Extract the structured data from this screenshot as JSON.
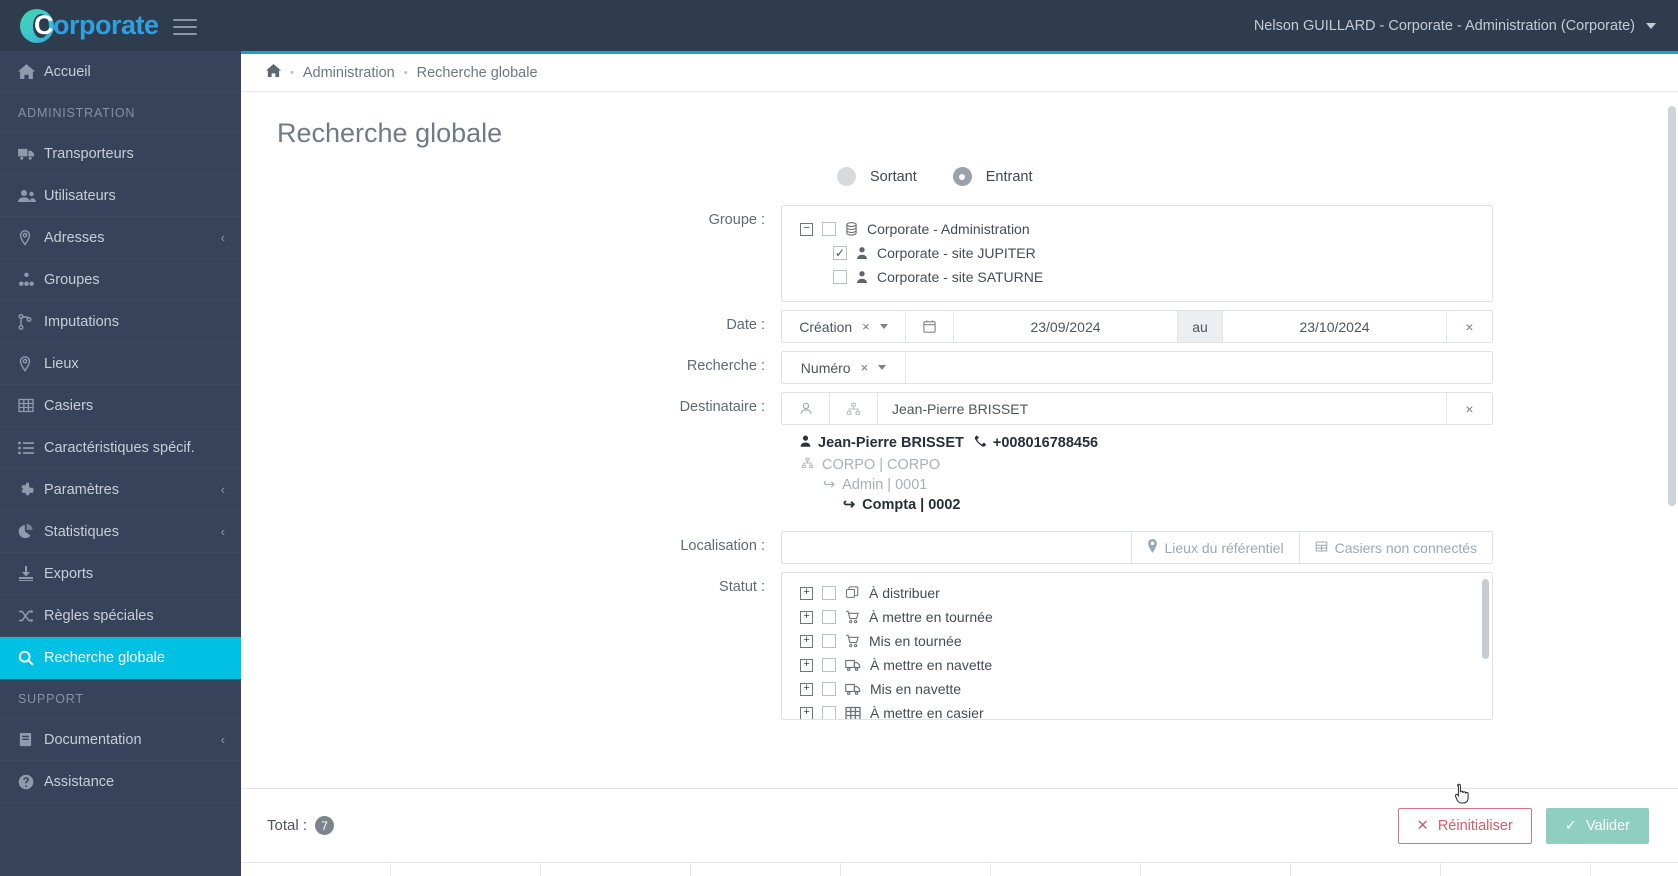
{
  "topbar": {
    "logo_c": "C",
    "logo_rest": "orporate",
    "user_menu": "Nelson GUILLARD - Corporate - Administration (Corporate)"
  },
  "sidebar": {
    "home": {
      "label": "Accueil",
      "icon": "home-icon"
    },
    "section_admin": "ADMINISTRATION",
    "section_support": "SUPPORT",
    "items": [
      {
        "label": "Transporteurs",
        "icon": "truck-icon",
        "caret": "",
        "active": false
      },
      {
        "label": "Utilisateurs",
        "icon": "users-icon",
        "caret": "",
        "active": false
      },
      {
        "label": "Adresses",
        "icon": "map-marker-icon",
        "caret": "‹",
        "active": false
      },
      {
        "label": "Groupes",
        "icon": "sitemap-icon",
        "caret": "",
        "active": false
      },
      {
        "label": "Imputations",
        "icon": "code-branch-icon",
        "caret": "",
        "active": false
      },
      {
        "label": "Lieux",
        "icon": "map-marker-icon",
        "caret": "",
        "active": false
      },
      {
        "label": "Casiers",
        "icon": "grid-icon",
        "caret": "",
        "active": false
      },
      {
        "label": "Caractéristiques spécif.",
        "icon": "list-icon",
        "caret": "",
        "active": false
      },
      {
        "label": "Paramètres",
        "icon": "gear-icon",
        "caret": "‹",
        "active": false
      },
      {
        "label": "Statistiques",
        "icon": "pie-chart-icon",
        "caret": "‹",
        "active": false
      },
      {
        "label": "Exports",
        "icon": "download-icon",
        "caret": "",
        "active": false
      },
      {
        "label": "Règles spéciales",
        "icon": "shuffle-icon",
        "caret": "",
        "active": false
      },
      {
        "label": "Recherche globale",
        "icon": "search-icon",
        "caret": "",
        "active": true
      }
    ],
    "support_items": [
      {
        "label": "Documentation",
        "icon": "book-icon",
        "caret": "‹"
      },
      {
        "label": "Assistance",
        "icon": "question-circle-icon",
        "caret": ""
      }
    ]
  },
  "breadcrumb": {
    "home_icon": "home-icon",
    "items": [
      "Administration",
      "Recherche globale"
    ]
  },
  "page": {
    "title": "Recherche globale"
  },
  "form": {
    "direction": {
      "options": [
        "Sortant",
        "Entrant"
      ],
      "selected": "Entrant"
    },
    "labels": {
      "groupe": "Groupe :",
      "date": "Date :",
      "recherche": "Recherche :",
      "destinataire": "Destinataire :",
      "localisation": "Localisation :",
      "statut": "Statut :"
    },
    "groupe_tree": [
      {
        "label": "Corporate - Administration",
        "level": 0,
        "expander": "−",
        "checked": false,
        "icon": "database-icon"
      },
      {
        "label": "Corporate - site JUPITER",
        "level": 1,
        "expander": "",
        "checked": true,
        "icon": "user-icon"
      },
      {
        "label": "Corporate - site SATURNE",
        "level": 1,
        "expander": "",
        "checked": false,
        "icon": "user-icon"
      }
    ],
    "date": {
      "type_value": "Création",
      "calendar_icon": "calendar-icon",
      "from": "23/09/2024",
      "separator": "au",
      "to": "23/10/2024",
      "clear_icon": "close-icon"
    },
    "recherche": {
      "type_value": "Numéro",
      "value": ""
    },
    "destinataire": {
      "user_icon": "user-outline-icon",
      "sitemap_icon": "sitemap-icon",
      "value": "Jean-Pierre BRISSET",
      "clear_icon": "close-icon"
    },
    "contact": {
      "name": "Jean-Pierre BRISSET",
      "phone": "+008016788456",
      "org": "CORPO | CORPO",
      "sub1": "Admin | 0001",
      "sub2": "Compta | 0002"
    },
    "localisation": {
      "value": "",
      "btn_lieux": "Lieux du référentiel",
      "btn_casiers": "Casiers non connectés"
    },
    "statut_tree": [
      {
        "label": "À distribuer",
        "expander": "+",
        "checked": false,
        "icon": "copy-icon"
      },
      {
        "label": "À mettre en tournée",
        "expander": "+",
        "checked": false,
        "icon": "cart-icon"
      },
      {
        "label": "Mis en tournée",
        "expander": "+",
        "checked": false,
        "icon": "cart-icon"
      },
      {
        "label": "À mettre en navette",
        "expander": "+",
        "checked": false,
        "icon": "shuttle-icon"
      },
      {
        "label": "Mis en navette",
        "expander": "+",
        "checked": false,
        "icon": "shuttle-icon"
      },
      {
        "label": "À mettre en casier",
        "expander": "+",
        "checked": false,
        "icon": "grid-icon"
      }
    ]
  },
  "footer": {
    "total_label": "Total :",
    "total_count": "7",
    "reset_label": "Réinitialiser",
    "validate_label": "Valider"
  },
  "colors": {
    "accent_cyan": "#00c0e4",
    "sidebar_bg": "#36435a",
    "topbar_bg": "#2f3c4e",
    "reset_red": "#cf5f6b",
    "validate_green": "#8fcfc0"
  }
}
